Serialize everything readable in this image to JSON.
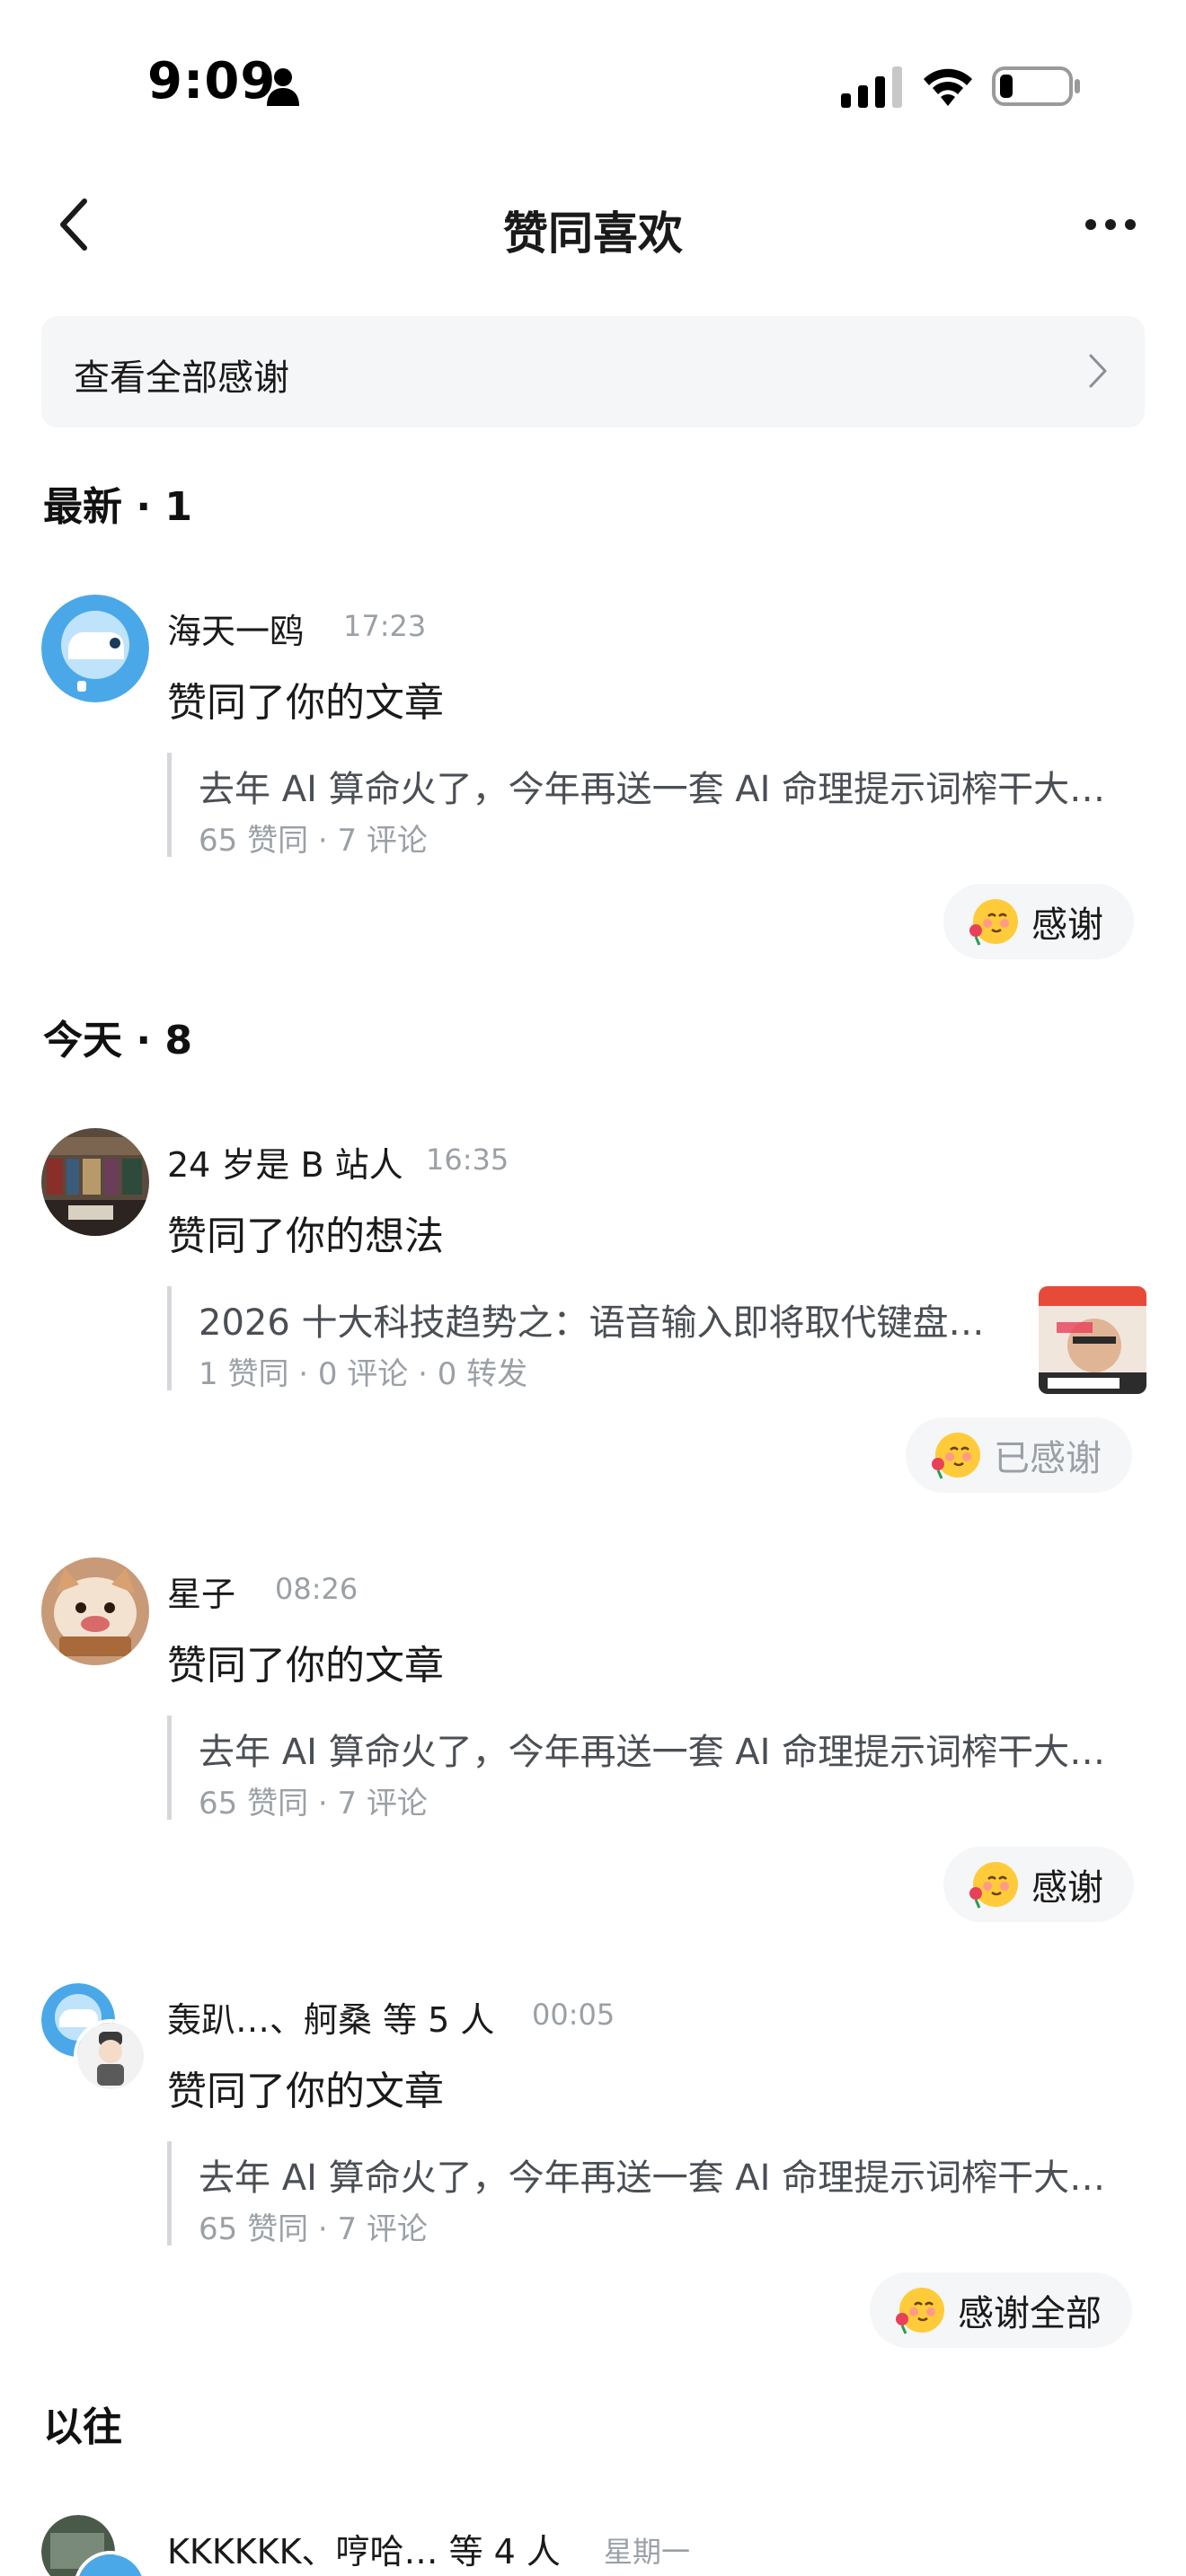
{
  "status": {
    "time": "9:09"
  },
  "nav": {
    "title": "赞同喜欢"
  },
  "thanks_bar": {
    "label": "查看全部感谢"
  },
  "sections": {
    "latest": "最新 · 1",
    "today": "今天 · 8",
    "past": "以往"
  },
  "items": [
    {
      "name": "海天一鸥",
      "time": "17:23",
      "action": "赞同了你的文章",
      "quote_title": "去年 AI 算命火了，今年再送一套 AI 命理提示词榨干大…",
      "quote_meta": "65 赞同 · 7 评论",
      "button": "感谢"
    },
    {
      "name": "24 岁是 B 站人",
      "time": "16:35",
      "action": "赞同了你的想法",
      "quote_title": "2026 十大科技趋势之：语音输入即将取代键盘…",
      "quote_meta": "1  赞同 · 0  评论 · 0  转发",
      "button": "已感谢"
    },
    {
      "name": "星子",
      "time": "08:26",
      "action": "赞同了你的文章",
      "quote_title": "去年 AI 算命火了，今年再送一套 AI 命理提示词榨干大…",
      "quote_meta": "65 赞同 · 7 评论",
      "button": "感谢"
    },
    {
      "name": "轰趴…、舸桑 等 5 人",
      "time": "00:05",
      "action": "赞同了你的文章",
      "quote_title": "去年 AI 算命火了，今年再送一套 AI 命理提示词榨干大…",
      "quote_meta": "65 赞同 · 7 评论",
      "button": "感谢全部"
    },
    {
      "name": "KKKKKK、哼哈… 等 4 人",
      "time": "星期一"
    }
  ],
  "colors": {
    "accent_bg": "#f5f6f8",
    "muted_text": "#9aa0a6"
  }
}
